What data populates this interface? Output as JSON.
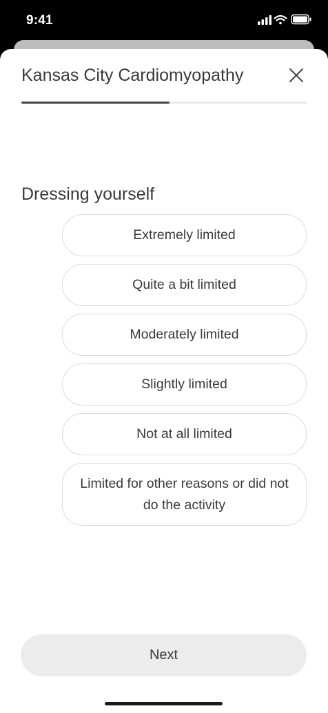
{
  "status_bar": {
    "time": "9:41",
    "icons": [
      "cellular-signal-icon",
      "wifi-icon",
      "battery-icon"
    ]
  },
  "sheet": {
    "title": "Kansas City Cardiomyopathy",
    "close_icon": "close-icon",
    "progress": 0.52
  },
  "question": {
    "text": "Dressing yourself",
    "options": [
      "Extremely limited",
      "Quite a bit limited",
      "Moderately limited",
      "Slightly limited",
      "Not at all limited",
      "Limited for other reasons or did not do the activity"
    ]
  },
  "footer": {
    "next_label": "Next"
  },
  "colors": {
    "text": "#3a3a3a",
    "progress_fill": "#444444",
    "progress_track": "#e8e8e8",
    "option_border": "#dcdcdc",
    "button_bg": "#ececec"
  }
}
